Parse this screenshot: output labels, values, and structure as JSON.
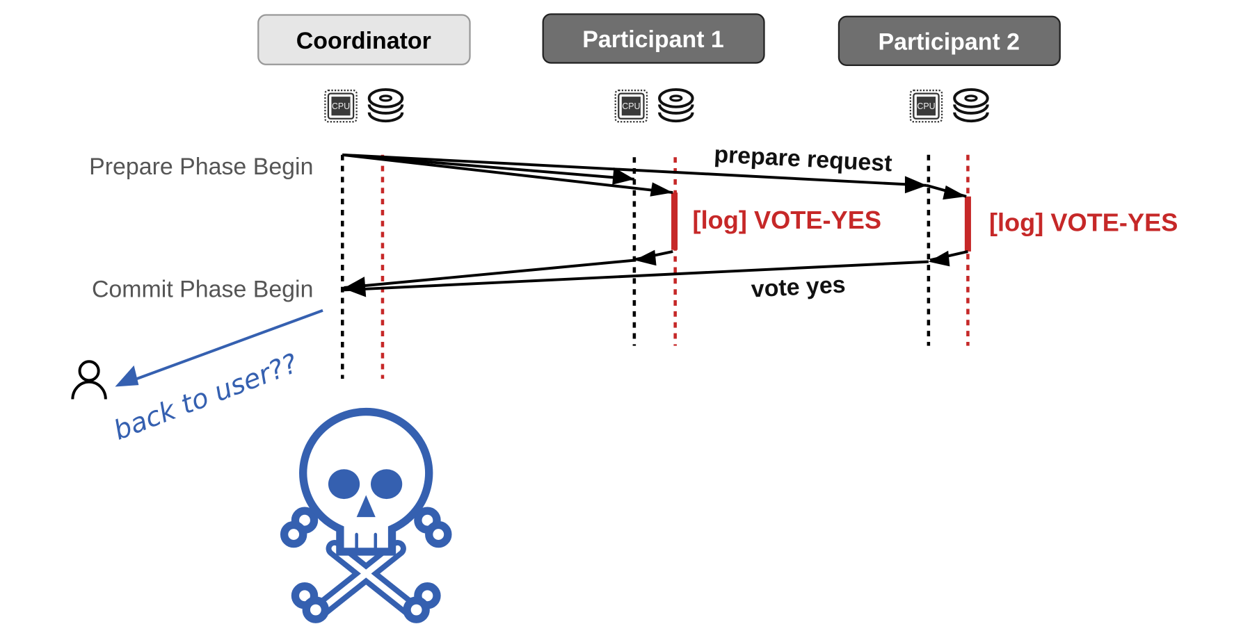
{
  "nodes": [
    {
      "label": "Coordinator",
      "fill": "#e6e6e6",
      "text_color": "#000000"
    },
    {
      "label": "Participant 1",
      "fill": "#6f6f6f",
      "text_color": "#ffffff"
    },
    {
      "label": "Participant 2",
      "fill": "#6f6f6f",
      "text_color": "#ffffff"
    }
  ],
  "resources": {
    "cpu_label": "CPU",
    "icons": [
      "cpu-icon",
      "disk-stack-icon"
    ]
  },
  "phases": {
    "prepare": "Prepare Phase Begin",
    "commit": "Commit Phase Begin"
  },
  "messages": {
    "prepare": "prepare request",
    "vote": "vote yes"
  },
  "log_entries": [
    "[log] VOTE-YES",
    "[log] VOTE-YES"
  ],
  "annotation": {
    "text": "back to user??",
    "color": "#3560b0",
    "icons": [
      "user-icon",
      "skull-crossbones-icon"
    ]
  },
  "colors": {
    "log": "#c62828",
    "lifeline_cpu": "#000000",
    "lifeline_disk": "#c62828"
  }
}
